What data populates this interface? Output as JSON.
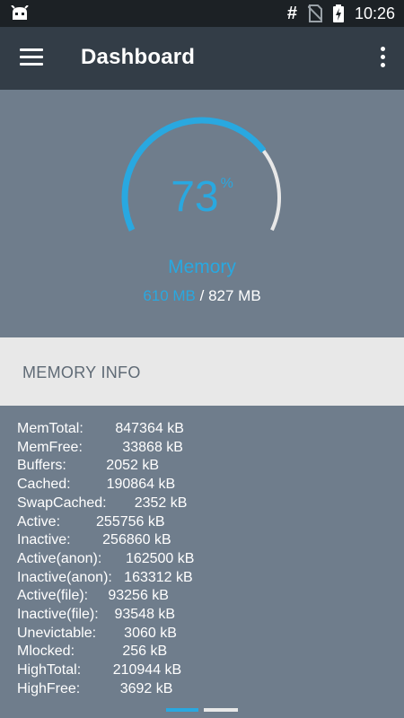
{
  "status_bar": {
    "time": "10:26",
    "icons": [
      "android-debug-icon",
      "hash-icon",
      "no-sim-icon",
      "battery-charging-icon"
    ]
  },
  "app_bar": {
    "title": "Dashboard",
    "menu_icon": "hamburger-menu-icon",
    "overflow_icon": "more-vert-icon"
  },
  "gauge": {
    "percent": "73",
    "percent_symbol": "%",
    "label": "Memory",
    "used": "610 MB",
    "separator": " / ",
    "total": "827 MB",
    "fill_fraction": 0.73,
    "accent_color": "#29a8e0",
    "track_color": "#e8e8e8"
  },
  "section": {
    "title": "MEMORY INFO"
  },
  "mem_info": [
    {
      "text": "MemTotal:        847364 kB"
    },
    {
      "text": "MemFree:          33868 kB"
    },
    {
      "text": "Buffers:          2052 kB"
    },
    {
      "text": "Cached:         190864 kB"
    },
    {
      "text": "SwapCached:       2352 kB"
    },
    {
      "text": "Active:         255756 kB"
    },
    {
      "text": "Inactive:        256860 kB"
    },
    {
      "text": "Active(anon):      162500 kB"
    },
    {
      "text": "Inactive(anon):   163312 kB"
    },
    {
      "text": "Active(file):     93256 kB"
    },
    {
      "text": "Inactive(file):    93548 kB"
    },
    {
      "text": "Unevictable:       3060 kB"
    },
    {
      "text": "Mlocked:            256 kB"
    },
    {
      "text": "HighTotal:        210944 kB"
    },
    {
      "text": "HighFree:          3692 kB"
    }
  ]
}
